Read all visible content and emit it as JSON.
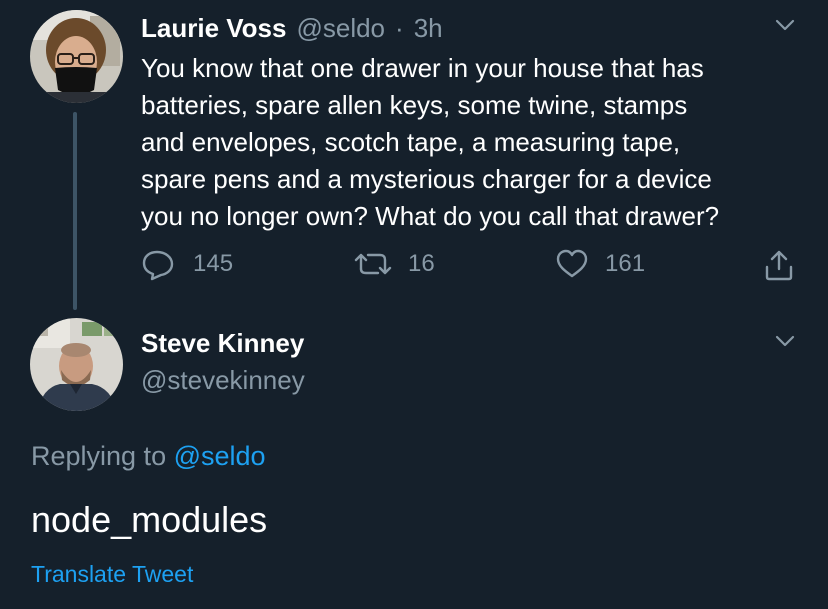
{
  "parent_tweet": {
    "author_name": "Laurie Voss",
    "author_handle": "@seldo",
    "separator": "·",
    "time": "3h",
    "text_lines": [
      "You know that one drawer in your house that has",
      "batteries, spare allen keys, some twine, stamps",
      "and envelopes, scotch tape, a measuring tape,",
      "spare pens and a mysterious charger for a device",
      "you no longer own? What do you call that drawer?"
    ],
    "replies_count": "145",
    "retweets_count": "16",
    "likes_count": "161",
    "icons": [
      "reply-icon",
      "retweet-icon",
      "like-icon",
      "share-icon",
      "chevron-down-icon"
    ]
  },
  "reply_tweet": {
    "author_name": "Steve Kinney",
    "author_handle": "@stevekinney",
    "replying_prefix": "Replying to",
    "replying_to": "@seldo",
    "text": "node_modules",
    "translate_label": "Translate Tweet"
  },
  "colors": {
    "background": "#15202b",
    "secondary_text": "#8899a6",
    "accent": "#1da1f2",
    "thread_line": "#3d5466"
  }
}
